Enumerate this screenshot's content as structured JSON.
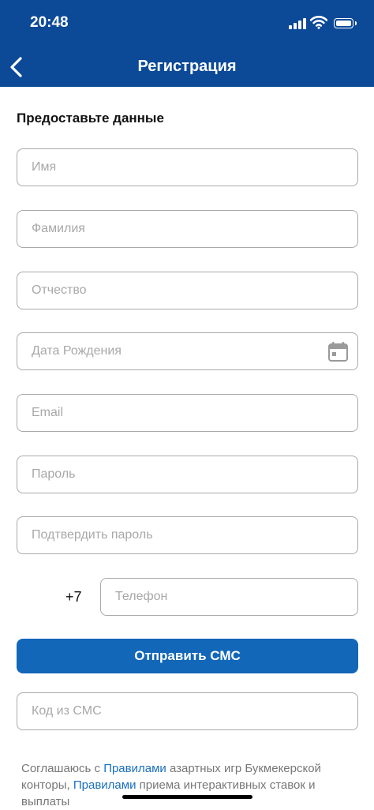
{
  "status_bar": {
    "time": "20:48"
  },
  "header": {
    "title": "Регистрация"
  },
  "form": {
    "section_title": "Предоставьте данные",
    "first_name_placeholder": "Имя",
    "last_name_placeholder": "Фамилия",
    "middle_name_placeholder": "Отчество",
    "birthdate_placeholder": "Дата Рождения",
    "email_placeholder": "Email",
    "password_placeholder": "Пароль",
    "confirm_password_placeholder": "Подтвердить пароль",
    "phone_prefix": "+7",
    "phone_placeholder": "Телефон",
    "send_sms_label": "Отправить СМС",
    "sms_code_placeholder": "Код из СМС"
  },
  "agreement": {
    "text1": "Соглашаюсь с ",
    "link1": "Правилами",
    "text2": " азартных игр Букмекерской конторы, ",
    "link2": "Правилами",
    "text3": " приема интерактивных ставок и выплаты"
  },
  "colors": {
    "brand": "#0c4a98",
    "button": "#1267b8",
    "link": "#1a6fc0"
  },
  "icons": [
    "signal-icon",
    "wifi-icon",
    "battery-icon",
    "back-chevron-icon",
    "calendar-icon"
  ]
}
